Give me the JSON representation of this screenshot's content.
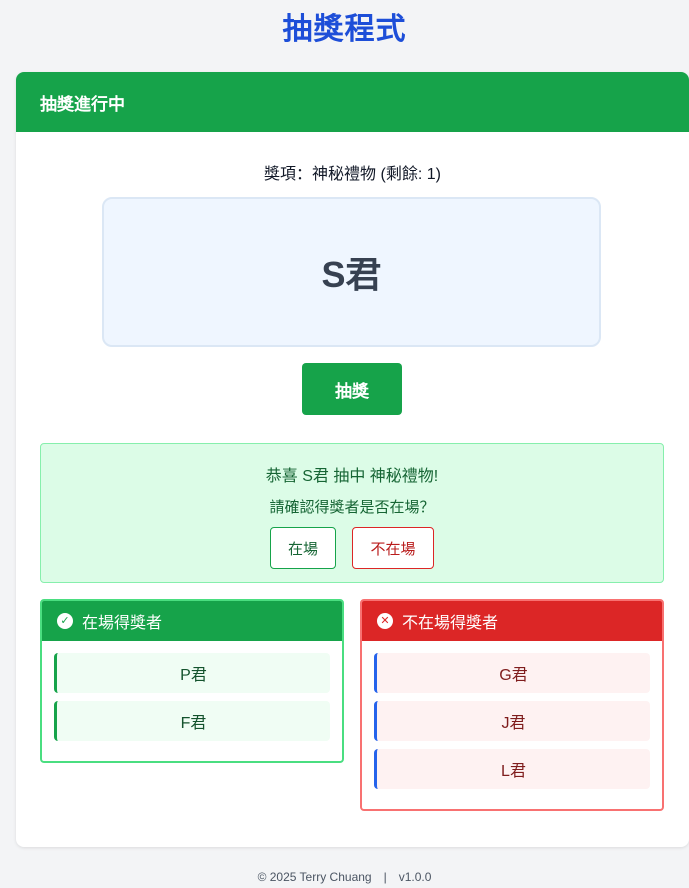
{
  "app": {
    "title": "抽獎程式"
  },
  "card": {
    "header": "抽獎進行中"
  },
  "prize": {
    "line": "獎項：神秘禮物 (剩餘: 1)"
  },
  "draw": {
    "display_name": "S君",
    "button_label": "抽獎"
  },
  "winner": {
    "message": "恭喜 S君 抽中 神秘禮物!",
    "confirm_prompt": "請確認得獎者是否在場？",
    "present_label": "在場",
    "absent_label": "不在場"
  },
  "present_panel": {
    "title": "在場得獎者",
    "icon": "check-circle-icon",
    "items": [
      "P君",
      "F君"
    ]
  },
  "absent_panel": {
    "title": "不在場得獎者",
    "icon": "x-circle-icon",
    "items": [
      "G君",
      "J君",
      "L君"
    ]
  },
  "footer": {
    "copyright": "© 2025 Terry Chuang",
    "separator": "|",
    "version": "v1.0.0"
  },
  "colors": {
    "title": "#1d4ed8",
    "success": "#16a34a",
    "danger": "#dc2626",
    "winner_bg": "#dcfce7",
    "display_bg": "#eff6ff"
  }
}
